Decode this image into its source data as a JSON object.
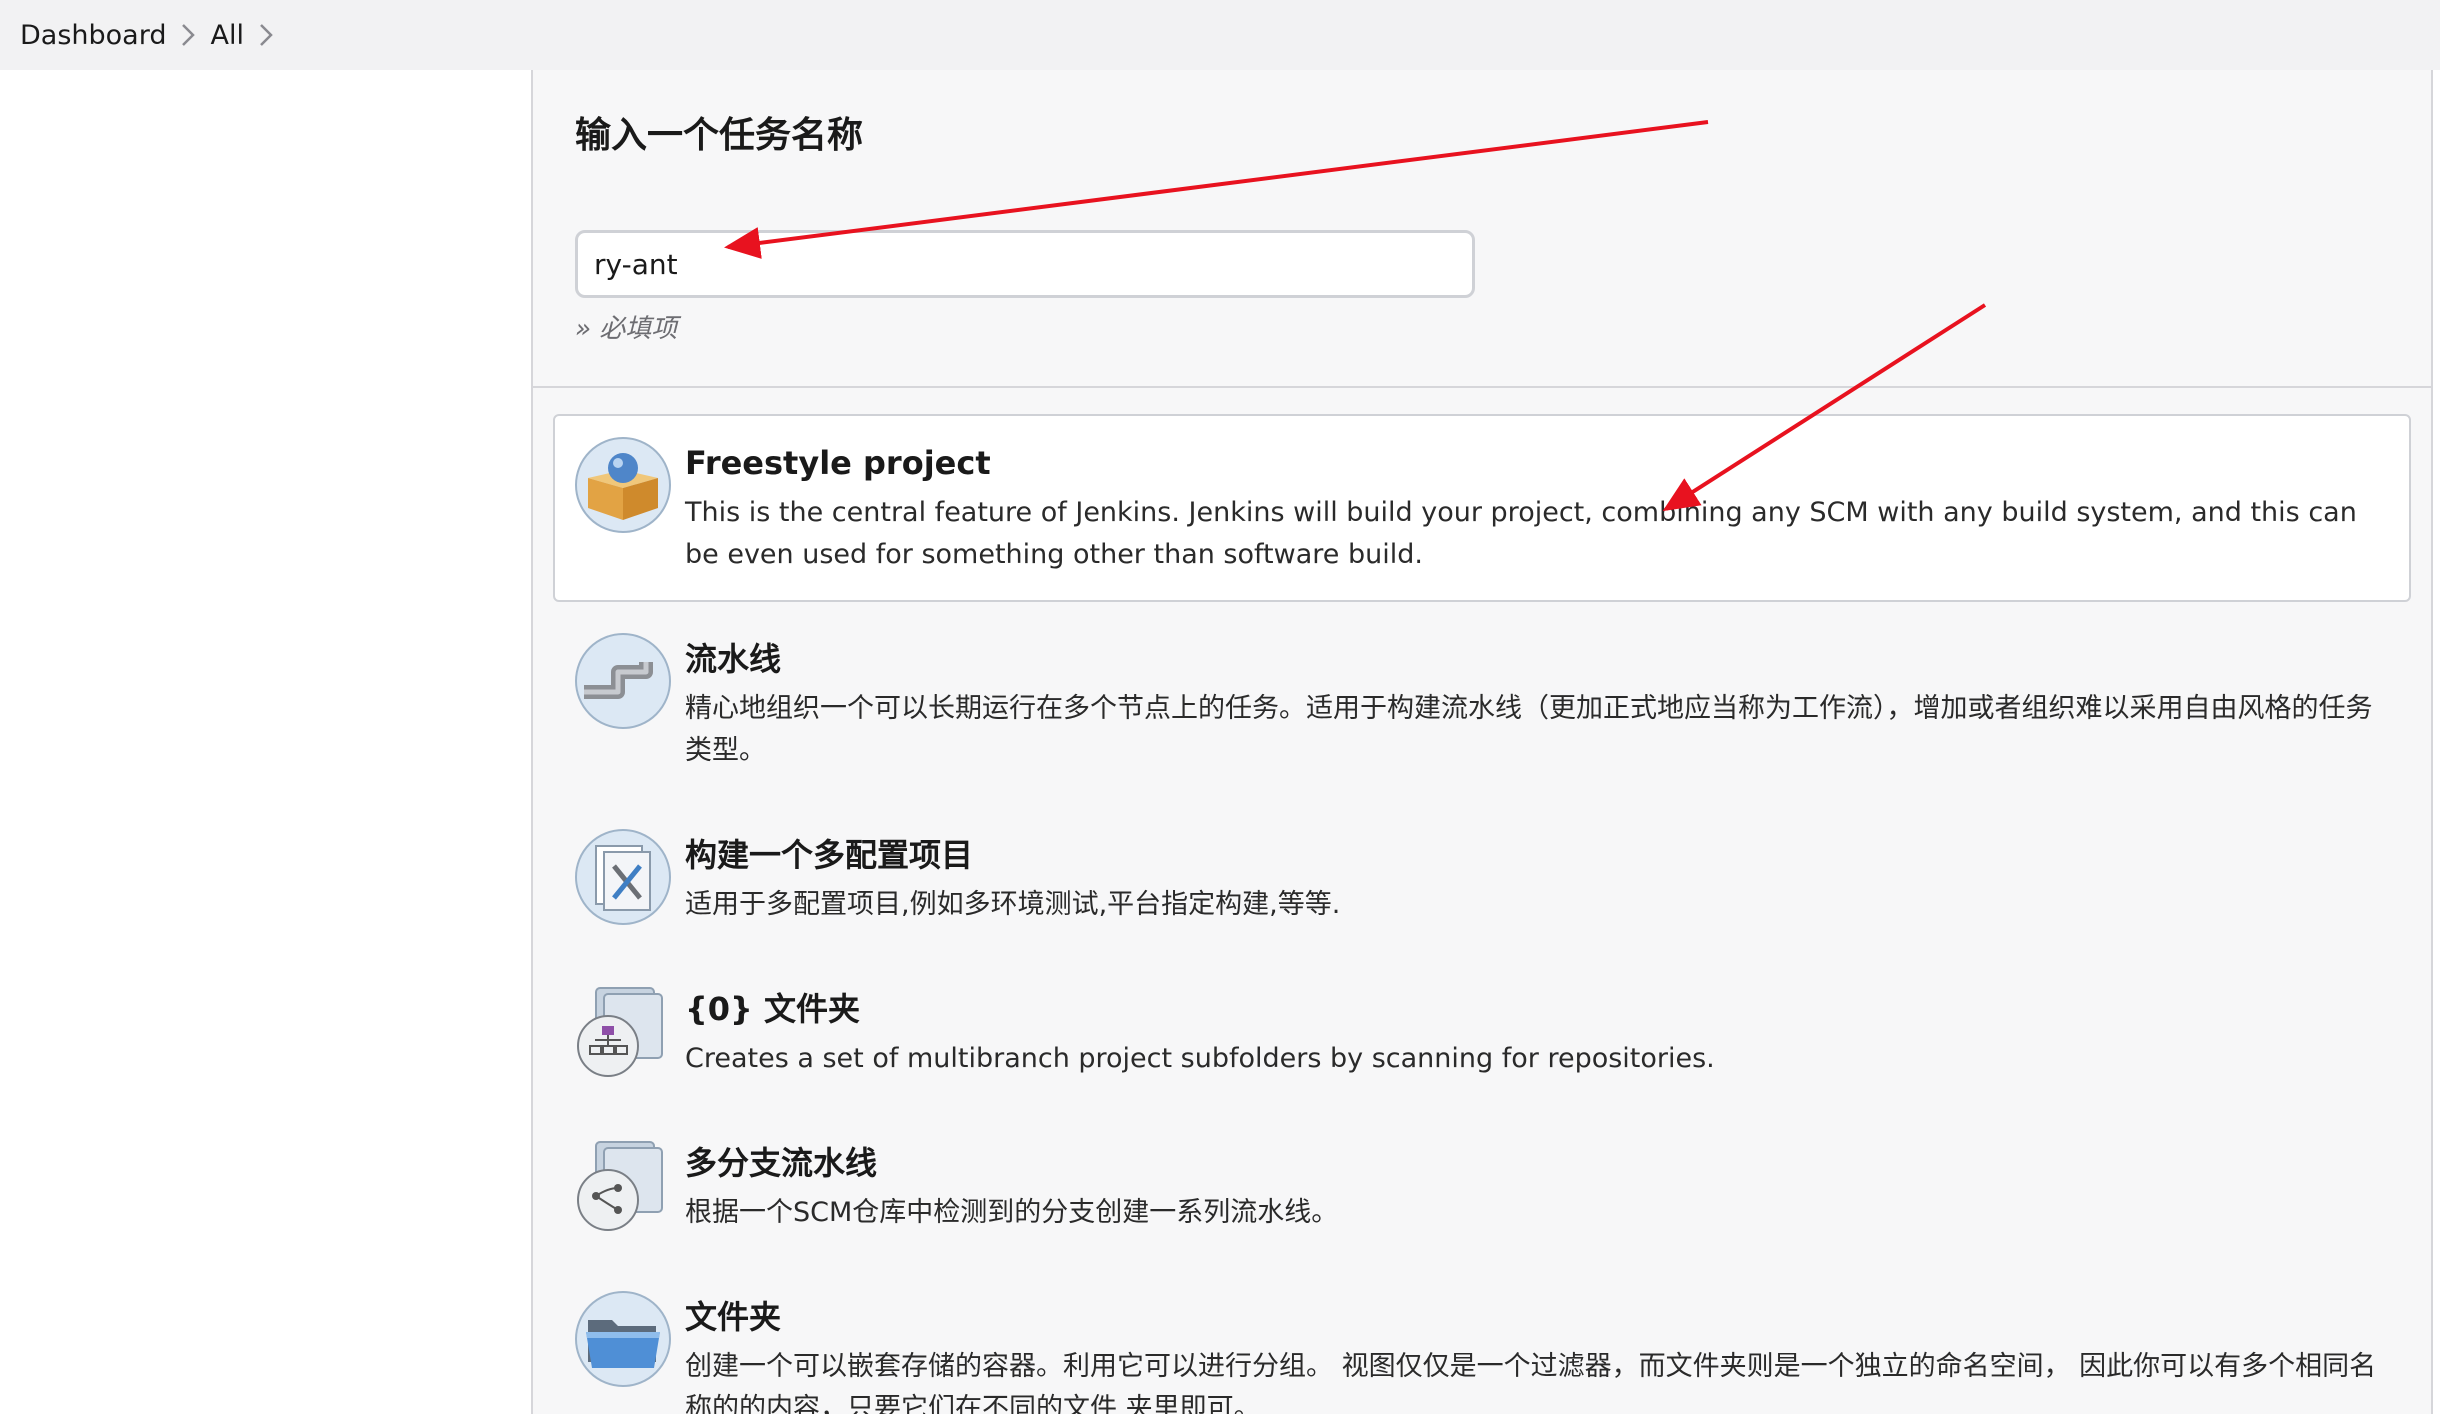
{
  "breadcrumb": {
    "items": [
      "Dashboard",
      "All"
    ]
  },
  "new_item": {
    "heading": "输入一个任务名称",
    "name_value": "ry-ant",
    "required_hint": "» 必填项"
  },
  "item_types": [
    {
      "title": "Freestyle project",
      "description": "This is the central feature of Jenkins. Jenkins will build your project, combining any SCM with any build system, and this can be even used for something other than software build.",
      "icon": "freestyle-box-icon",
      "selected": true
    },
    {
      "title": "流水线",
      "description": "精心地组织一个可以长期运行在多个节点上的任务。适用于构建流水线（更加正式地应当称为工作流），增加或者组织难以采用自由风格的任务类型。",
      "icon": "pipeline-pipe-icon",
      "selected": false
    },
    {
      "title": "构建一个多配置项目",
      "description": "适用于多配置项目,例如多环境测试,平台指定构建,等等.",
      "icon": "multi-config-tools-icon",
      "selected": false
    },
    {
      "title": "{0} 文件夹",
      "description": "Creates a set of multibranch project subfolders by scanning for repositories.",
      "icon": "organization-folder-icon",
      "selected": false
    },
    {
      "title": "多分支流水线",
      "description": "根据一个SCM仓库中检测到的分支创建一系列流水线。",
      "icon": "multibranch-pipeline-icon",
      "selected": false
    },
    {
      "title": "文件夹",
      "description": "创建一个可以嵌套存储的容器。利用它可以进行分组。 视图仅仅是一个过滤器，而文件夹则是一个独立的命名空间， 因此你可以有多个相同名称的的内容，只要它们在不同的文件 夹里即可。",
      "icon": "folder-icon",
      "selected": false
    }
  ],
  "colors": {
    "annotation_arrow": "#e8121f",
    "selected_border": "#cfd1d6",
    "page_background": "#f7f7f8"
  }
}
